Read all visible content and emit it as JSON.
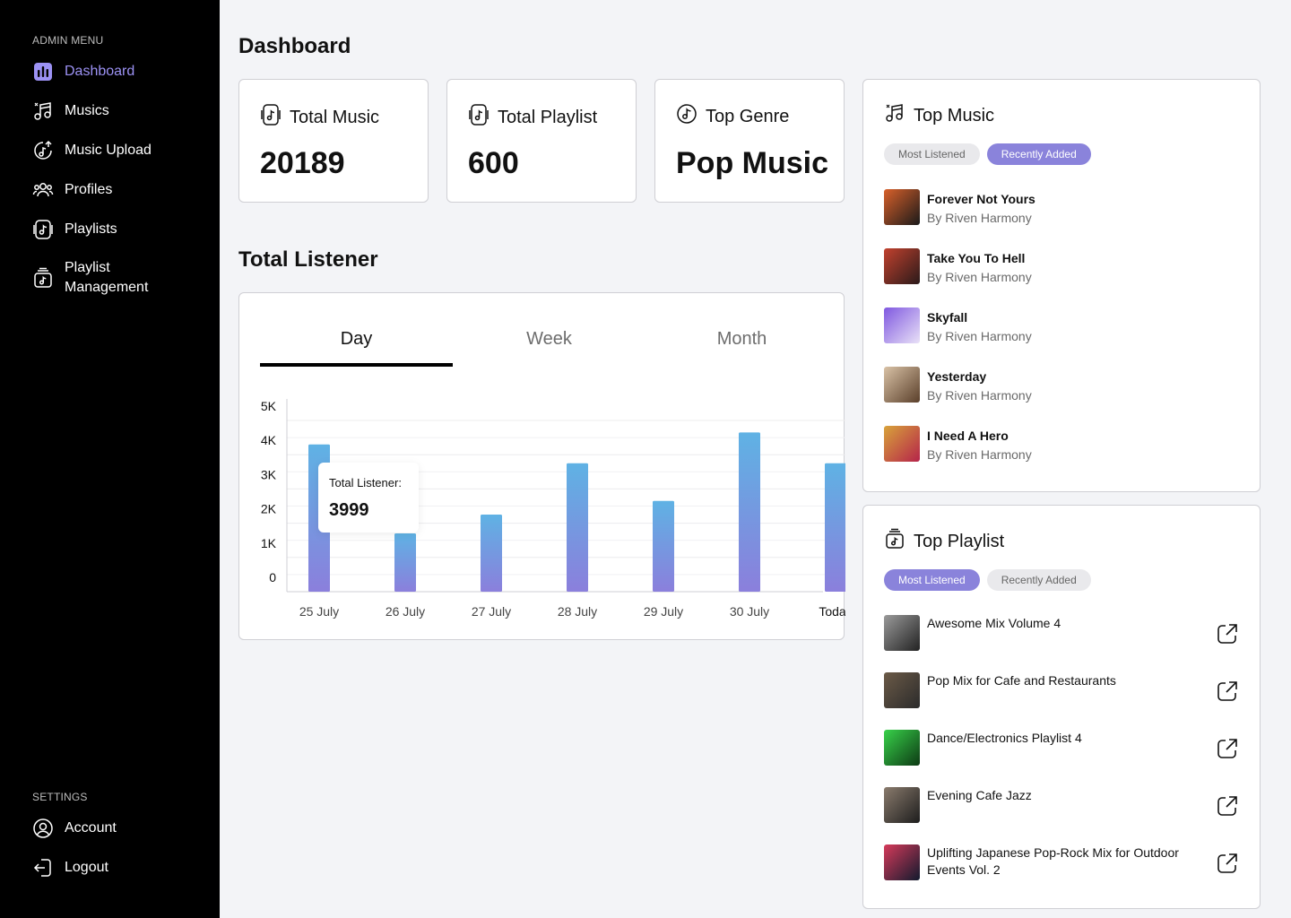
{
  "sidebar": {
    "admin_heading": "ADMIN MENU",
    "items": [
      {
        "label": "Dashboard",
        "icon": "bar-chart-icon",
        "active": true
      },
      {
        "label": "Musics",
        "icon": "music-notes-icon"
      },
      {
        "label": "Music Upload",
        "icon": "music-upload-icon"
      },
      {
        "label": "Profiles",
        "icon": "users-icon"
      },
      {
        "label": "Playlists",
        "icon": "playlist-icon"
      },
      {
        "label": "Playlist Management",
        "icon": "playlist-box-icon"
      }
    ],
    "settings_heading": "SETTINGS",
    "settings_items": [
      {
        "label": "Account",
        "icon": "user-circle-icon"
      },
      {
        "label": "Logout",
        "icon": "logout-icon"
      }
    ],
    "accent_color": "#9c92f4"
  },
  "header": {
    "title": "Dashboard"
  },
  "stats": [
    {
      "label": "Total Music",
      "value": "20189",
      "icon": "music-file-icon"
    },
    {
      "label": "Total Playlist",
      "value": "600",
      "icon": "music-file-icon"
    },
    {
      "label": "Top Genre",
      "value": "Pop Music",
      "icon": "disc-note-icon"
    }
  ],
  "listener": {
    "title": "Total Listener",
    "tabs": [
      {
        "label": "Day",
        "active": true
      },
      {
        "label": "Week"
      },
      {
        "label": "Month"
      }
    ],
    "tooltip": {
      "label": "Total Listener:",
      "value": "3999"
    }
  },
  "chart_data": {
    "type": "bar",
    "categories": [
      "25 July",
      "26 July",
      "27 July",
      "28 July",
      "29 July",
      "30 July",
      "Today"
    ],
    "values": [
      4300,
      1700,
      2250,
      3750,
      2650,
      4650,
      3750
    ],
    "y_ticks": [
      "0",
      "1K",
      "2K",
      "3K",
      "4K",
      "5K"
    ],
    "ylim": [
      0,
      5000
    ],
    "grid": true,
    "bar_gradient": [
      "#5fb2e4",
      "#8b7fdc"
    ]
  },
  "top_music": {
    "title": "Top Music",
    "filters": [
      {
        "label": "Most Listened"
      },
      {
        "label": "Recently Added",
        "active": true
      }
    ],
    "tracks": [
      {
        "title": "Forever Not Yours",
        "artist": "By Riven Harmony",
        "colors": [
          "#d9602a",
          "#1a1a1a"
        ]
      },
      {
        "title": "Take You To Hell",
        "artist": "By Riven Harmony",
        "colors": [
          "#c2412e",
          "#2a1a1a"
        ]
      },
      {
        "title": "Skyfall",
        "artist": "By Riven Harmony",
        "colors": [
          "#7f58e0",
          "#e9e1f7"
        ]
      },
      {
        "title": "Yesterday",
        "artist": "By Riven Harmony",
        "colors": [
          "#d9c2a6",
          "#5a3f2a"
        ]
      },
      {
        "title": "I Need A Hero",
        "artist": "By Riven Harmony",
        "colors": [
          "#d8a33a",
          "#b5244a"
        ]
      }
    ]
  },
  "top_playlist": {
    "title": "Top Playlist",
    "filters": [
      {
        "label": "Most Listened",
        "active": true
      },
      {
        "label": "Recently Added"
      }
    ],
    "items": [
      {
        "title": "Awesome Mix Volume 4",
        "colors": [
          "#9a9a9a",
          "#222"
        ]
      },
      {
        "title": "Pop Mix for Cafe and Restaurants",
        "colors": [
          "#6b5a47",
          "#2b2b2b"
        ]
      },
      {
        "title": "Dance/Electronics Playlist 4",
        "colors": [
          "#38d24a",
          "#0d3a14"
        ]
      },
      {
        "title": "Evening Cafe Jazz",
        "colors": [
          "#8a7b6d",
          "#1d1d1d"
        ]
      },
      {
        "title": "Uplifting Japanese Pop-Rock Mix for Outdoor Events Vol. 2",
        "colors": [
          "#d63a5a",
          "#121a2e"
        ]
      }
    ]
  }
}
